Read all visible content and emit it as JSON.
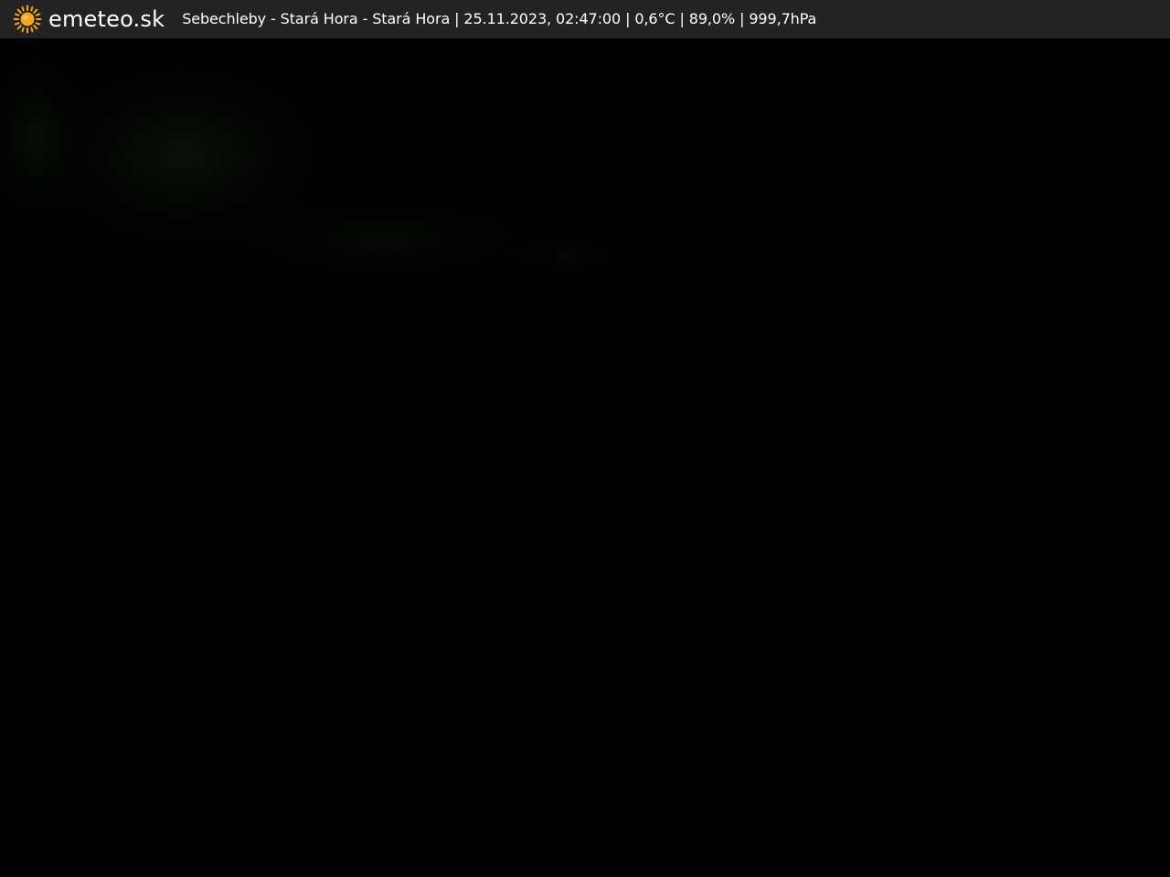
{
  "brand": {
    "name": "emeteo.sk",
    "icon": "sun-icon",
    "icon_color": "#f5a623"
  },
  "caption": {
    "location": "Sebechleby - Stará Hora - Stará Hora",
    "datetime": "25.11.2023, 02:47:00",
    "temperature": "0,6°C",
    "humidity": "89,0%",
    "pressure": "999,7hPa",
    "separator": " | "
  },
  "colors": {
    "bar_background": "#242424",
    "text": "#ffffff",
    "image_background": "#000000"
  }
}
